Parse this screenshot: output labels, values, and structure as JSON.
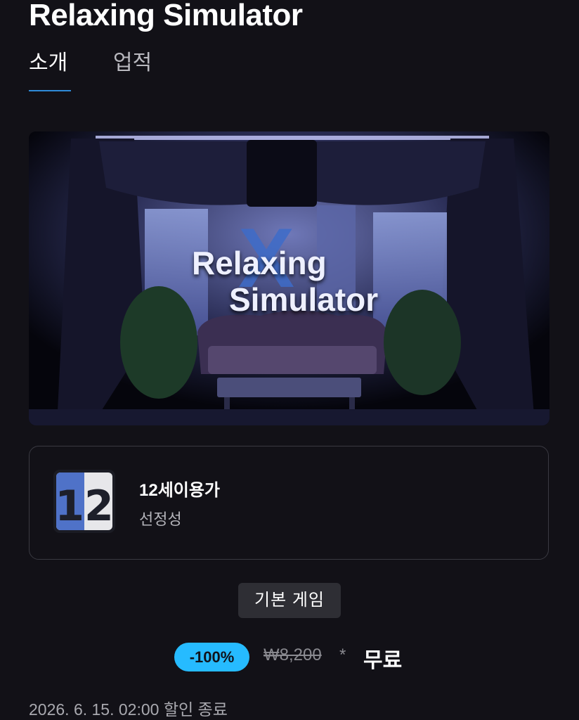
{
  "header": {
    "title": "Relaxing Simulator"
  },
  "tabs": [
    {
      "label": "소개",
      "active": true
    },
    {
      "label": "업적",
      "active": false
    }
  ],
  "hero": {
    "logo_line1": "Relaxing",
    "logo_line2": "Simulator",
    "logo_mark": "X"
  },
  "rating": {
    "badge_text": "12",
    "title": "12세이용가",
    "descriptor": "선정성"
  },
  "base_game_label": "기본 게임",
  "price": {
    "discount": "-100%",
    "original": "₩8,200",
    "asterisk": "*",
    "final": "무료"
  },
  "sale_end": "2026. 6. 15. 02:00 할인 종료",
  "colors": {
    "background": "#121117",
    "accent_tab": "#2f8bd8",
    "discount_badge": "#26bbff"
  }
}
